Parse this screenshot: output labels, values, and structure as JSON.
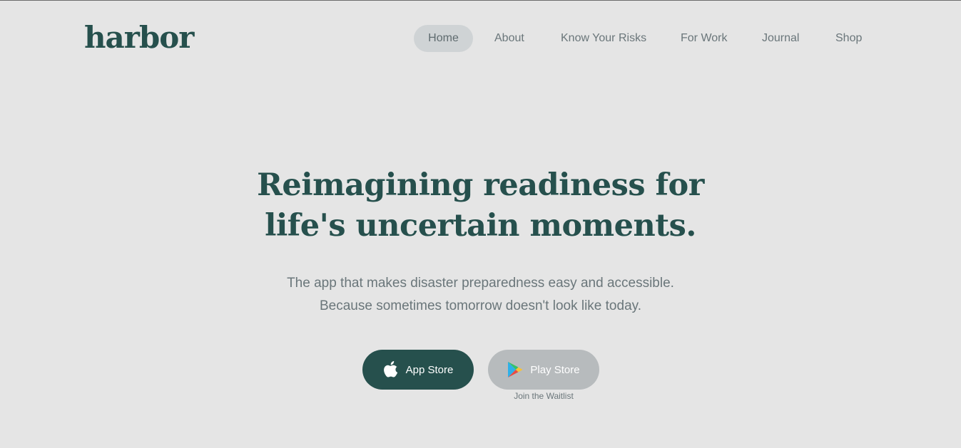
{
  "brand": {
    "logo": "harbor"
  },
  "nav": {
    "items": [
      {
        "label": "Home",
        "active": true
      },
      {
        "label": "About",
        "active": false
      },
      {
        "label": "Know Your Risks",
        "active": false
      },
      {
        "label": "For Work",
        "active": false
      },
      {
        "label": "Journal",
        "active": false
      },
      {
        "label": "Shop",
        "active": false
      }
    ]
  },
  "hero": {
    "title_line1": "Reimagining readiness for",
    "title_line2": "life's uncertain moments.",
    "subtitle_line1": "The app that makes disaster preparedness easy and accessible.",
    "subtitle_line2": "Because sometimes tomorrow doesn't look like today."
  },
  "cta": {
    "app_store": {
      "label": "App Store",
      "icon": "apple-icon"
    },
    "play_store": {
      "label": "Play Store",
      "icon": "google-play-icon"
    },
    "waitlist": "Join the Waitlist"
  },
  "colors": {
    "background": "#e5e5e5",
    "brand": "#26504d",
    "muted_text": "#6a767a",
    "nav_active_bg": "#cfd3d5",
    "disabled_button": "#b7bbbd"
  }
}
